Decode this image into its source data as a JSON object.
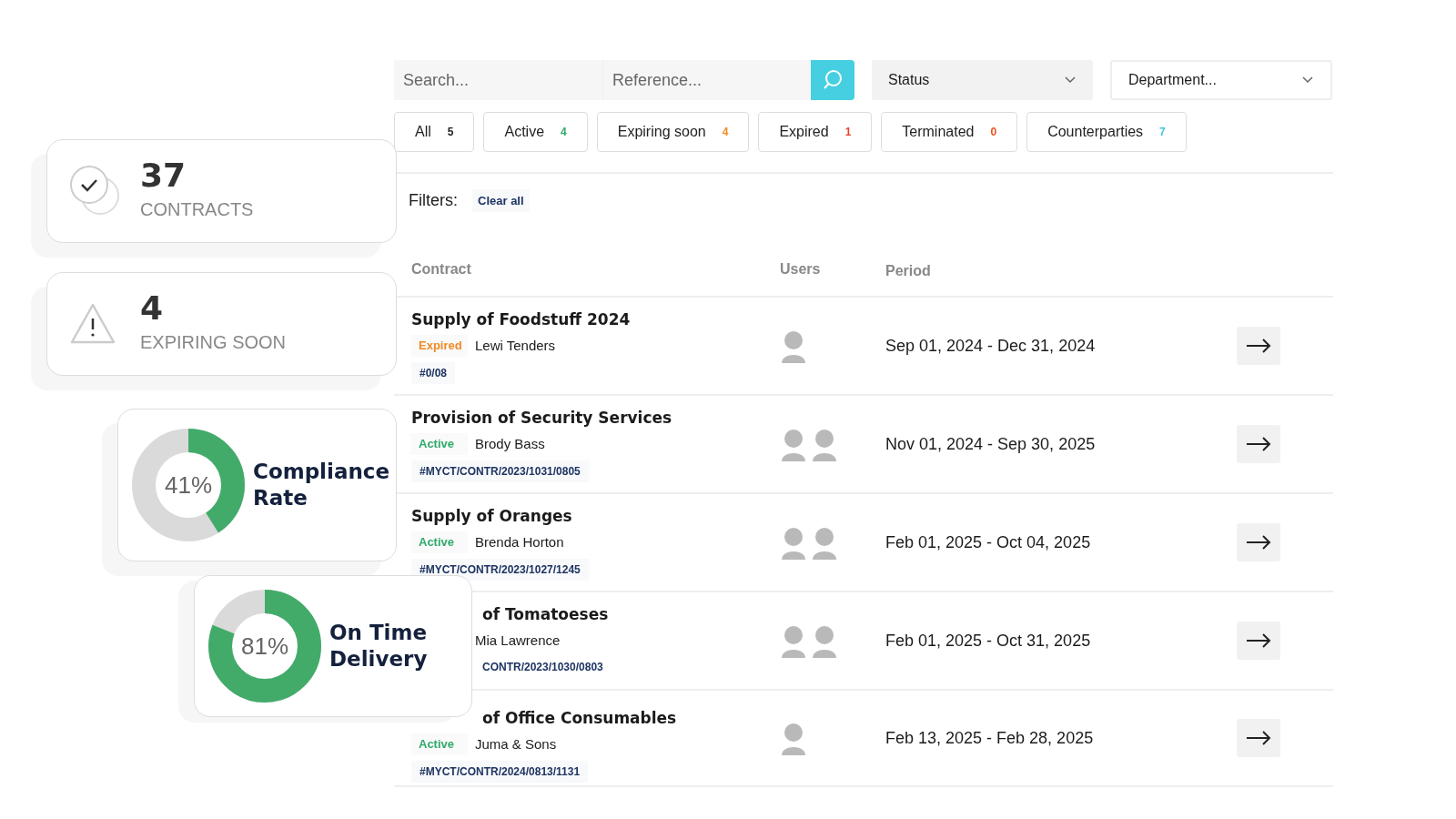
{
  "search": {
    "placeholder": "Search..."
  },
  "reference": {
    "placeholder": "Reference..."
  },
  "status_select": {
    "value": "Status"
  },
  "department_select": {
    "value": "Department..."
  },
  "tabs": [
    {
      "label": "All",
      "count": "5",
      "color": "#222222",
      "selected": false
    },
    {
      "label": "Active",
      "count": "4",
      "color": "#2eaa6a",
      "selected": false
    },
    {
      "label": "Expiring soon",
      "count": "4",
      "color": "#f08a24",
      "selected": false
    },
    {
      "label": "Expired",
      "count": "1",
      "color": "#e8412c",
      "selected": false
    },
    {
      "label": "Terminated",
      "count": "0",
      "color": "#f0501f",
      "selected": false
    },
    {
      "label": "Counterparties",
      "count": "7",
      "color": "#3cc4dc",
      "selected": false
    }
  ],
  "filters": {
    "label": "Filters:",
    "clear": "Clear all"
  },
  "table": {
    "columns": [
      "Contract",
      "Users",
      "Period"
    ],
    "rows": [
      {
        "title": "Supply of Foodstuff 2024",
        "status": "Expired",
        "color": "#f08a24",
        "party": "Lewi Tenders",
        "ref": "#0/08",
        "users": [
          {
            "kind": "avatar"
          }
        ],
        "period": "Sep 01, 2024 - Dec 31, 2024"
      },
      {
        "title": "Provision of Security Services",
        "status": "Active",
        "color": "#2eaa6a",
        "party": "Brody Bass",
        "ref": "#MYCT/CONTR/2023/1031/0805",
        "users": [
          {
            "kind": "avatar"
          },
          {
            "kind": "avatar"
          }
        ],
        "period": "Nov 01, 2024 - Sep 30, 2025"
      },
      {
        "title": "Supply of Oranges",
        "status": "Active",
        "color": "#2eaa6a",
        "party": "Brenda Horton",
        "ref": "#MYCT/CONTR/2023/1027/1245",
        "users": [
          {
            "kind": "avatar"
          },
          {
            "kind": "avatar"
          }
        ],
        "period": "Feb 01, 2025 - Oct 04, 2025"
      },
      {
        "title": "of Tomatoeses",
        "party": "Mia Lawrence",
        "ref": "CONTR/2023/1030/0803",
        "users": [
          {
            "kind": "avatar"
          },
          {
            "kind": "avatar"
          }
        ],
        "period": "Feb 01, 2025 - Oct 31, 2025"
      },
      {
        "title": "of Office Consumables",
        "status": "Active",
        "color": "#2eaa6a",
        "party": "Juma & Sons",
        "ref": "#MYCT/CONTR/2024/0813/1131",
        "users": [
          {
            "kind": "avatar"
          }
        ],
        "period": "Feb 13, 2025 - Feb 28, 2025"
      }
    ]
  },
  "stat_cards": [
    {
      "kind": "check",
      "value": "37",
      "label": "CONTRACTS"
    },
    {
      "kind": "warning",
      "value": "4",
      "label": "EXPIRING SOON"
    }
  ],
  "meters": [
    {
      "reading": "41%",
      "level": 0.41,
      "title": "Compliance Rate"
    },
    {
      "reading": "81%",
      "level": 0.81,
      "title": "On Time Delivery"
    }
  ]
}
